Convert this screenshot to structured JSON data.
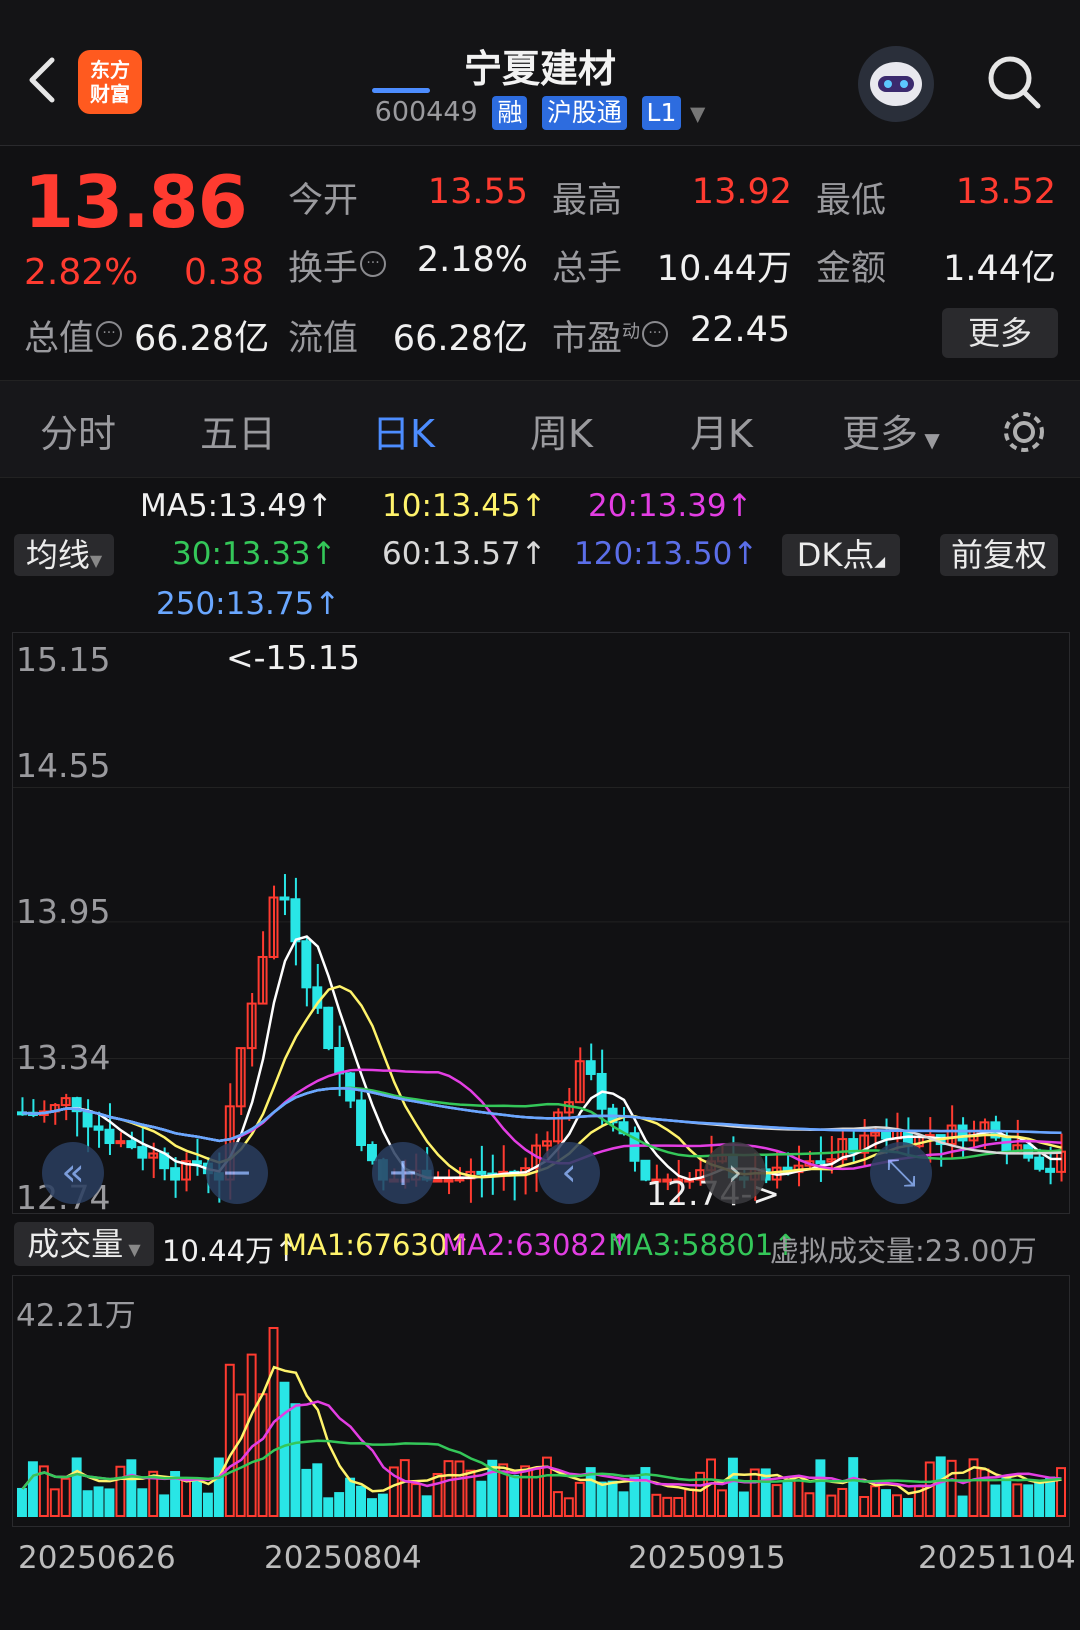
{
  "header": {
    "stock_name": "宁夏建材",
    "code": "600449",
    "tags": [
      "融",
      "沪股通",
      "L1"
    ],
    "logo_line1": "东方",
    "logo_line2": "财富"
  },
  "quote": {
    "price": "13.86",
    "pct": "2.82%",
    "change": "0.38",
    "open_label": "今开",
    "open": "13.55",
    "high_label": "最高",
    "high": "13.92",
    "low_label": "最低",
    "low": "13.52",
    "turnover_label": "换手",
    "turnover": "2.18%",
    "volume_label": "总手",
    "volume": "10.44万",
    "amount_label": "金额",
    "amount": "1.44亿",
    "mktcap_label": "总值",
    "mktcap": "66.28亿",
    "float_label": "流值",
    "float": "66.28亿",
    "pe_label": "市盈",
    "pe_sup": "动",
    "pe": "22.45",
    "more": "更多"
  },
  "tabs": [
    "分时",
    "五日",
    "日K",
    "周K",
    "月K",
    "更多"
  ],
  "active_tab": "日K",
  "ma_legend": {
    "ma5": "MA5:13.49",
    "ma10": "10:13.45",
    "ma20": "20:13.39",
    "ma30": "30:13.33",
    "ma60": "60:13.57",
    "ma120": "120:13.50",
    "ma250": "250:13.75",
    "ma_button": "均线",
    "dk_button": "DK点",
    "fq_button": "前复权"
  },
  "colors": {
    "up": "#ff3b30",
    "down": "#29e6e6",
    "ma5": "#ffffff",
    "ma10": "#fff36b",
    "ma20": "#e33ee3",
    "ma30": "#34c759",
    "ma60": "#d8d8d8",
    "ma120": "#5b6ee8",
    "ma250": "#6aa7ff"
  },
  "kchart": {
    "y_labels": [
      "15.15",
      "14.55",
      "13.95",
      "13.34",
      "12.74"
    ],
    "max_note": "<-15.15",
    "min_note": "12.74->",
    "ymin": 12.74,
    "ymax": 15.15
  },
  "volume_legend": {
    "label": "成交量",
    "vol": "10.44万",
    "ma1": "MA1:67630",
    "ma2": "MA2:63082",
    "ma3": "MA3:58801",
    "virtual": "虚拟成交量:23.00万"
  },
  "vchart": {
    "y_label": "42.21万"
  },
  "x_labels": [
    "20250626",
    "20250804",
    "20250915",
    "20251104"
  ],
  "arrow_up": "↑"
}
